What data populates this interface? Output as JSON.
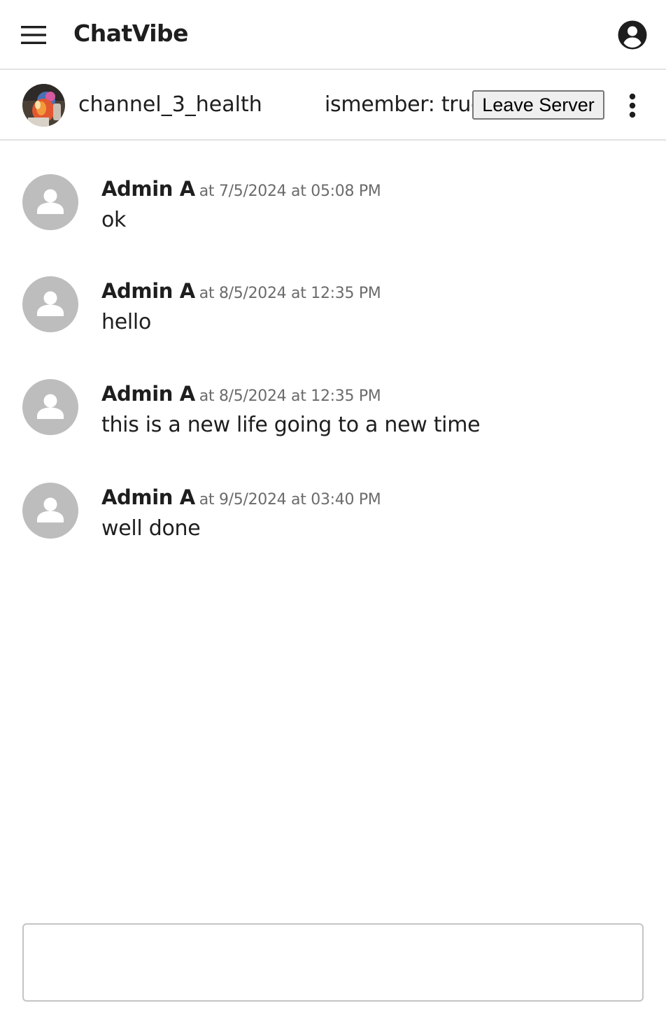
{
  "app": {
    "title": "ChatVibe",
    "menu_icon": "hamburger-menu-icon",
    "account_icon": "account-circle-icon"
  },
  "channel": {
    "name": "channel_3_health",
    "member_status": "ismember: true",
    "leave_label": "Leave Server",
    "more_icon": "more-vertical-icon"
  },
  "messages": [
    {
      "author": "Admin A",
      "timestamp": "at 7/5/2024 at 05:08 PM",
      "text": "ok"
    },
    {
      "author": "Admin A",
      "timestamp": "at 8/5/2024 at 12:35 PM",
      "text": "hello"
    },
    {
      "author": "Admin A",
      "timestamp": "at 8/5/2024 at 12:35 PM",
      "text": "this is a new life going to a new time"
    },
    {
      "author": "Admin A",
      "timestamp": "at 9/5/2024 at 03:40 PM",
      "text": "well done"
    }
  ],
  "composer": {
    "value": "",
    "placeholder": ""
  },
  "colors": {
    "text": "#1e1e1e",
    "timestamp": "#6b6b6b",
    "avatar_bg": "#bdbdbd",
    "divider": "#e2e2e2"
  }
}
